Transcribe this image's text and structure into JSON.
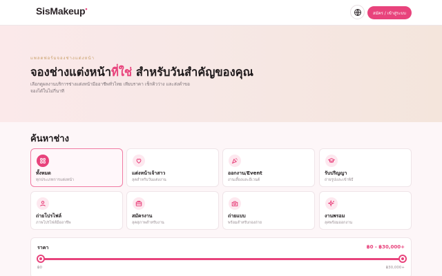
{
  "header": {
    "logo": "SisMakeup",
    "logo_mark": "•",
    "signin_label": "สมัคร / เข้าสู่ระบบ",
    "language_icon": "globe-icon"
  },
  "hero": {
    "eyebrow": "แพลตฟอร์มจองช่างแต่งหน้า",
    "title_before": "จองช่างแต่งหน้า",
    "title_accent": "ที่ใช่",
    "title_after": " สำหรับวันสำคัญของคุณ",
    "subtitle": "เลือกดูผลงานบริการช่างแต่งหน้ามืออาชีพทั่วไทย เทียบราคา เช็กคิวว่าง และส่งคำขอจองได้ในไม่กี่นาที"
  },
  "search": {
    "title": "ค้นหาช่าง",
    "categories": [
      {
        "name": "ทั้งหมด",
        "desc": "ทุกประเภทการแต่งหน้า",
        "icon": "grid-icon",
        "active": true
      },
      {
        "name": "แต่งหน้าเจ้าสาว",
        "desc": "ลุคสำหรับวันแต่งงาน",
        "icon": "heart-icon",
        "active": false
      },
      {
        "name": "ออกงาน/Event",
        "desc": "งานเลี้ยงและอีเวนต์",
        "icon": "party-icon",
        "active": false
      },
      {
        "name": "รับปริญญา",
        "desc": "ถ่ายรูปและเข้าพิธี",
        "icon": "graduation-cap-icon",
        "active": false
      },
      {
        "name": "ถ่ายโปรไฟล์",
        "desc": "ภาพโปรไฟล์มืออาชีพ",
        "icon": "person-icon",
        "active": false
      },
      {
        "name": "สมัครงาน",
        "desc": "ลุคสุภาพสำหรับงาน",
        "icon": "briefcase-icon",
        "active": false
      },
      {
        "name": "ถ่ายแบบ",
        "desc": "พร้อมสำหรับกองถ่าย",
        "icon": "camera-icon",
        "active": false
      },
      {
        "name": "งานพรอม",
        "desc": "ลุคพร้อมออกงาน",
        "icon": "sparkles-icon",
        "active": false
      }
    ]
  },
  "price": {
    "label": "ราคา",
    "value_text": "฿0 - ฿30,000+",
    "min_label": "฿0",
    "max_label": "฿30,000+",
    "selected_min_fraction": 0,
    "selected_max_fraction": 1
  },
  "colors": {
    "accent": "#e8437c",
    "eyebrow": "#c9a06a"
  }
}
